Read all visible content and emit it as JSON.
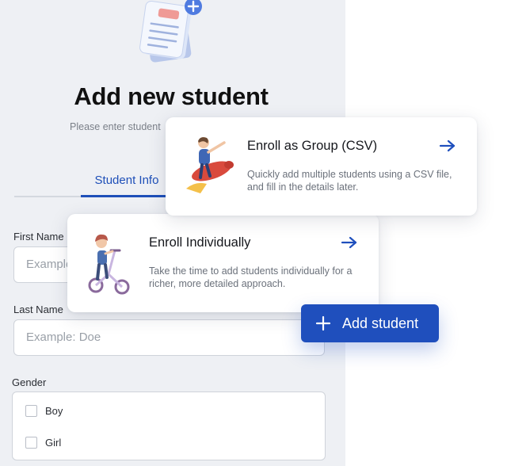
{
  "header": {
    "title": "Add new student",
    "subtitle": "Please enter student"
  },
  "tabs": [
    {
      "label": "Student Info",
      "active": true
    }
  ],
  "form": {
    "first_name": {
      "label": "First Name",
      "placeholder": "Example"
    },
    "last_name": {
      "label": "Last Name",
      "placeholder": "Example: Doe"
    },
    "gender": {
      "label": "Gender",
      "options": [
        "Boy",
        "Girl"
      ]
    }
  },
  "cards": {
    "group": {
      "title": "Enroll as Group (CSV)",
      "description_line1": "Quickly add multiple students using a CSV file,",
      "description_line2": "and fill in the details later."
    },
    "individual": {
      "title": "Enroll Individually",
      "description_line1": "Take the time to add students individually for a",
      "description_line2": "richer, more detailed approach."
    }
  },
  "add_button": {
    "label": "Add student",
    "icon": "plus-icon"
  },
  "colors": {
    "accent": "#1f4fbd",
    "panel_bg": "#eef0f4"
  }
}
